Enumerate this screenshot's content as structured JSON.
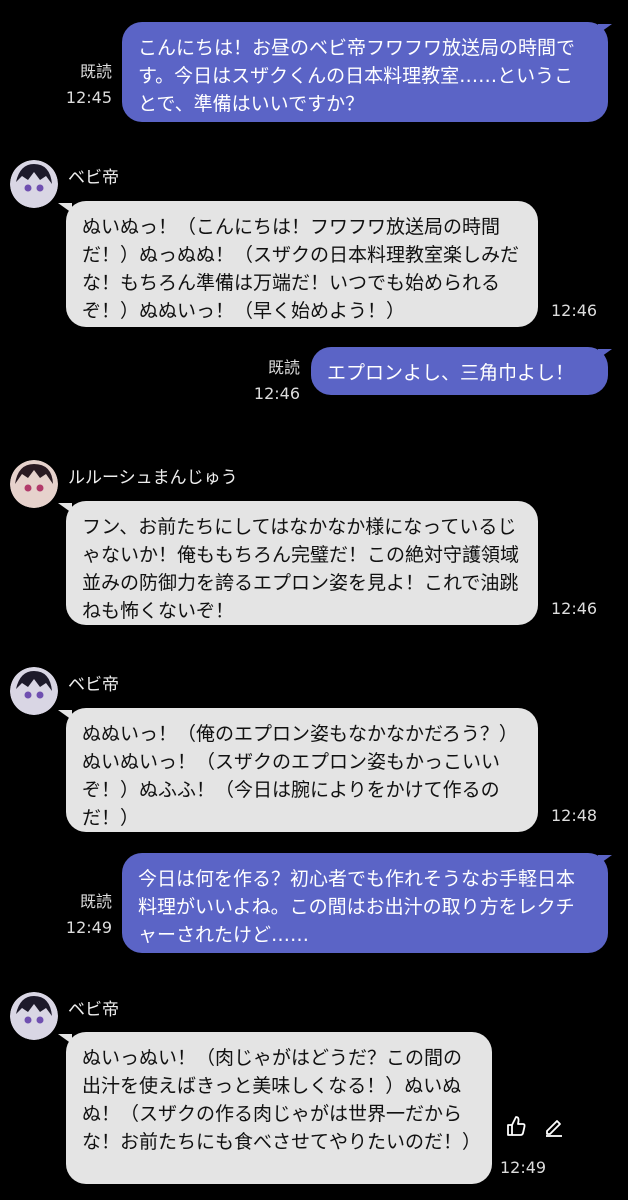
{
  "messages": [
    {
      "text": "こんにちは！お昼のベビ帝フワフワ放送局の時間です。今日はスザクくんの日本料理教室……ということで、準備はいいですか？",
      "read": "既読",
      "time": "12:45"
    },
    {
      "sender": "ベビ帝",
      "text": "ぬいぬっ！（こんにちは！フワフワ放送局の時間だ！）ぬっぬぬ！（スザクの日本料理教室楽しみだな！もちろん準備は万端だ！いつでも始められるぞ！）ぬぬいっ！（早く始めよう！）",
      "time": "12:46"
    },
    {
      "text": "エプロンよし、三角巾よし！",
      "read": "既読",
      "time": "12:46"
    },
    {
      "sender": "ルルーシュまんじゅう",
      "text": "フン、お前たちにしてはなかなか様になっているじゃないか！俺ももちろん完璧だ！この絶対守護領域並みの防御力を誇るエプロン姿を見よ！これで油跳ねも怖くないぞ！",
      "time": "12:46"
    },
    {
      "sender": "ベビ帝",
      "text": "ぬぬいっ！（俺のエプロン姿もなかなかだろう？）ぬいぬいっ！（スザクのエプロン姿もかっこいいぞ！）ぬふふ！（今日は腕によりをかけて作るのだ！）",
      "time": "12:48"
    },
    {
      "text": "今日は何を作る？初心者でも作れそうなお手軽日本料理がいいよね。この間はお出汁の取り方をレクチャーされたけど……",
      "read": "既読",
      "time": "12:49"
    },
    {
      "sender": "ベビ帝",
      "text": "ぬいっぬい！（肉じゃがはどうだ？この間の出汁を使えばきっと美味しくなる！）ぬいぬぬ！（スザクの作る肉じゃがは世界一だからな！お前たちにも食べさせてやりたいのだ！）",
      "time": "12:49"
    }
  ],
  "colors": {
    "outgoing": "#5b64c6",
    "incoming": "#e4e4e4",
    "background": "#000000"
  },
  "icons": {
    "like": "thumbs-up-icon",
    "edit": "pencil-icon"
  }
}
